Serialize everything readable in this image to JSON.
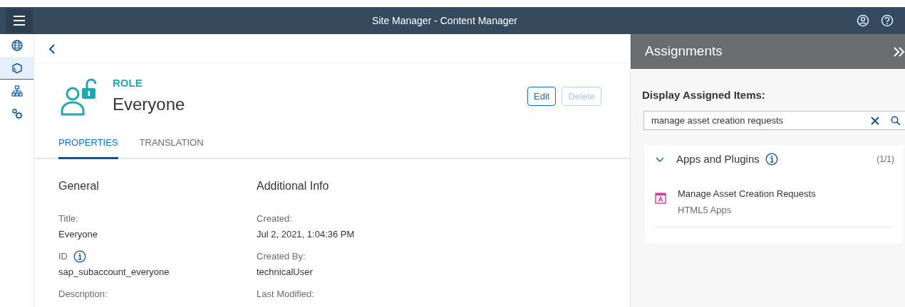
{
  "header": {
    "title": "Site Manager - Content Manager"
  },
  "sidebar": {
    "items": [
      {
        "kind": "globe",
        "selected": false
      },
      {
        "kind": "cube",
        "selected": true
      },
      {
        "kind": "sitemap",
        "selected": false
      },
      {
        "kind": "gears",
        "selected": false
      }
    ]
  },
  "role": {
    "type_label": "ROLE",
    "name": "Everyone"
  },
  "actions": [
    {
      "label": "Edit",
      "disabled": false
    },
    {
      "label": "Delete",
      "disabled": true
    }
  ],
  "tabs": [
    {
      "label": "PROPERTIES",
      "selected": true
    },
    {
      "label": "TRANSLATION",
      "selected": false
    }
  ],
  "sections": [
    {
      "title": "General",
      "fields": [
        {
          "label": "Title:",
          "value": "Everyone"
        },
        {
          "label": "ID",
          "info": true,
          "value": "sap_subaccount_everyone"
        },
        {
          "label": "Description:"
        }
      ]
    },
    {
      "title": "Additional Info",
      "fields": [
        {
          "label": "Created:",
          "value": "Jul 2, 2021, 1:04:36 PM"
        },
        {
          "label": "Created By:",
          "value": "technicalUser"
        },
        {
          "label": "Last Modified:"
        }
      ]
    }
  ],
  "assignments": {
    "title": "Assignments",
    "filter_label": "Display Assigned Items:",
    "search": {
      "value": "manage asset creation requests"
    },
    "groups": [
      {
        "title": "Apps and Plugins",
        "info": true,
        "expanded": true,
        "count": "(1/1)",
        "items": [
          {
            "title": "Manage Asset Creation Requests",
            "subtitle": "HTML5 Apps"
          }
        ]
      }
    ]
  }
}
